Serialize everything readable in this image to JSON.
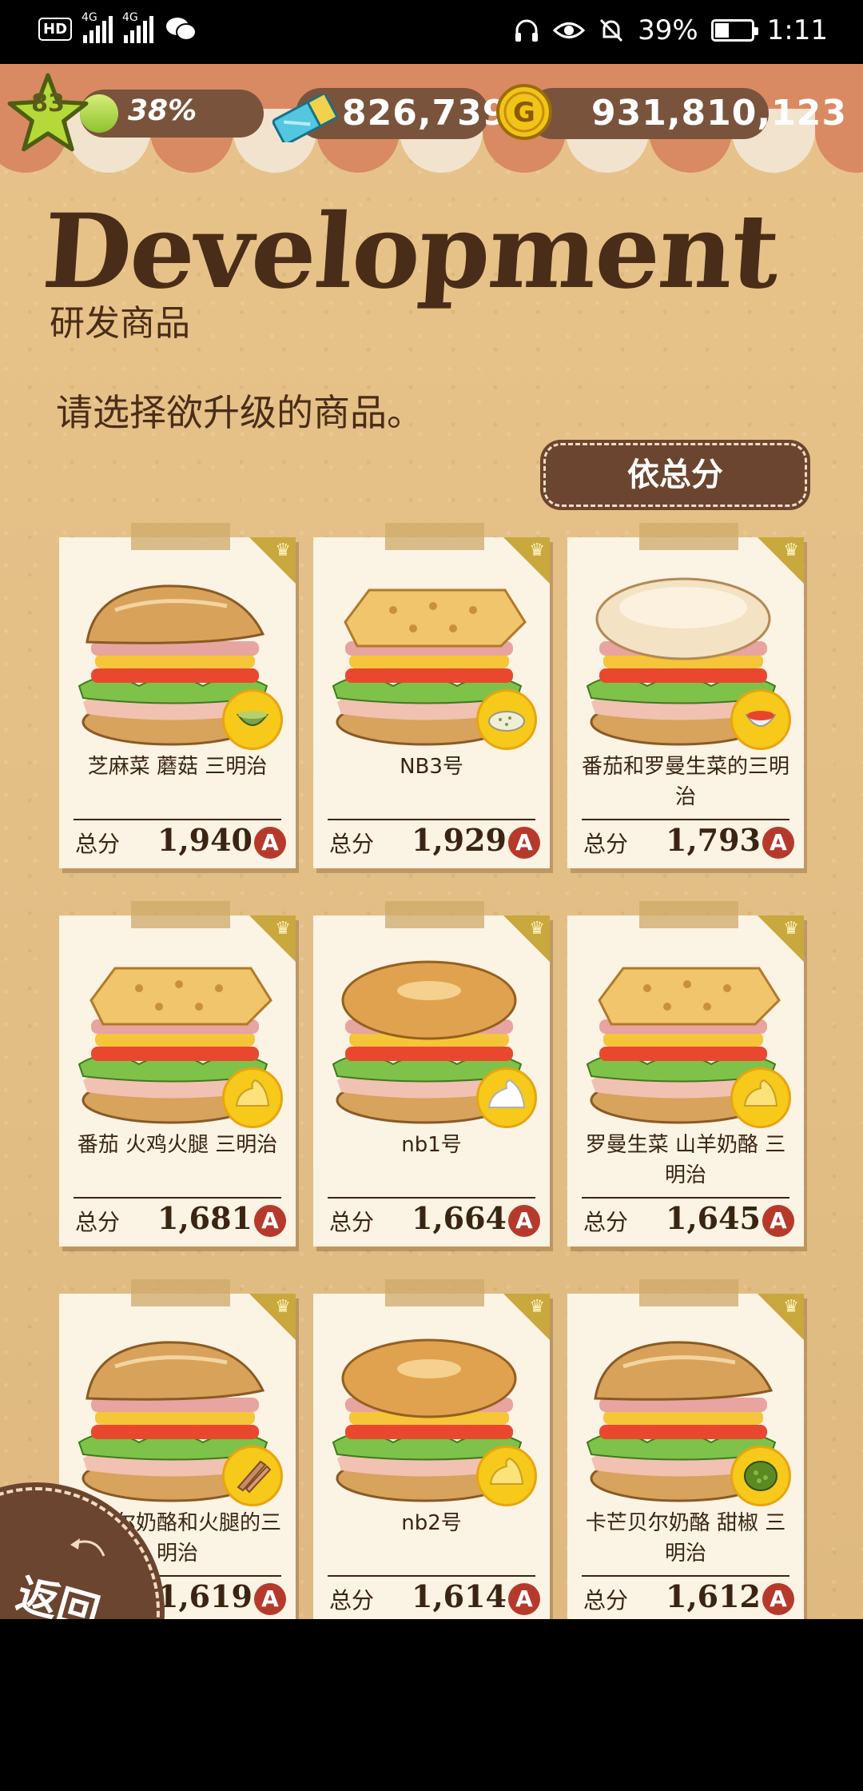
{
  "status_bar": {
    "network_label_1": "4G",
    "network_label_2": "4G",
    "battery_percent": "39%",
    "battery_level": 0.39,
    "time": "1:11"
  },
  "hud": {
    "level": "83",
    "xp_percent": "38%",
    "tickets": "826,739",
    "coins": "931,810,123",
    "coin_symbol": "G"
  },
  "header": {
    "title": "Development",
    "subtitle": "研发商品"
  },
  "instruction": "请选择欲升级的商品。",
  "sort_button": "依总分",
  "score_label": "总分",
  "grade": "A",
  "products": [
    {
      "name": "芝麻菜 蘑菇 三明治",
      "score": "1,940",
      "bread": "ciabatta",
      "badge_icon": "sauce-cup-icon"
    },
    {
      "name": "NB3号",
      "score": "1,929",
      "bread": "focaccia",
      "badge_icon": "herb-salt-icon"
    },
    {
      "name": "番茄和罗曼生菜的三明治",
      "score": "1,793",
      "bread": "muffin",
      "badge_icon": "tomato-sauce-icon"
    },
    {
      "name": "番茄 火鸡火腿 三明治",
      "score": "1,681",
      "bread": "focaccia",
      "badge_icon": "mayo-icon"
    },
    {
      "name": "nb1号",
      "score": "1,664",
      "bread": "bagel",
      "badge_icon": "cream-icon"
    },
    {
      "name": "罗曼生菜 山羊奶酪 三明治",
      "score": "1,645",
      "bread": "focaccia",
      "badge_icon": "mayo-icon"
    },
    {
      "name": "芒贝尔奶酪和火腿的三明治",
      "score": "1,619",
      "bread": "ciabatta",
      "badge_icon": "anchovy-icon"
    },
    {
      "name": "nb2号",
      "score": "1,614",
      "bread": "bagel",
      "badge_icon": "mayo-icon"
    },
    {
      "name": "卡芒贝尔奶酪 甜椒 三明治",
      "score": "1,612",
      "bread": "ciabatta",
      "badge_icon": "green-relish-icon"
    }
  ],
  "back_button": "返回",
  "colors": {
    "background": "#e3bf86",
    "brown": "#6b4530",
    "dark_text": "#3a2412",
    "awning": "#d98a62",
    "grade_red": "#b63a2c",
    "gold": "#f6c91a"
  }
}
